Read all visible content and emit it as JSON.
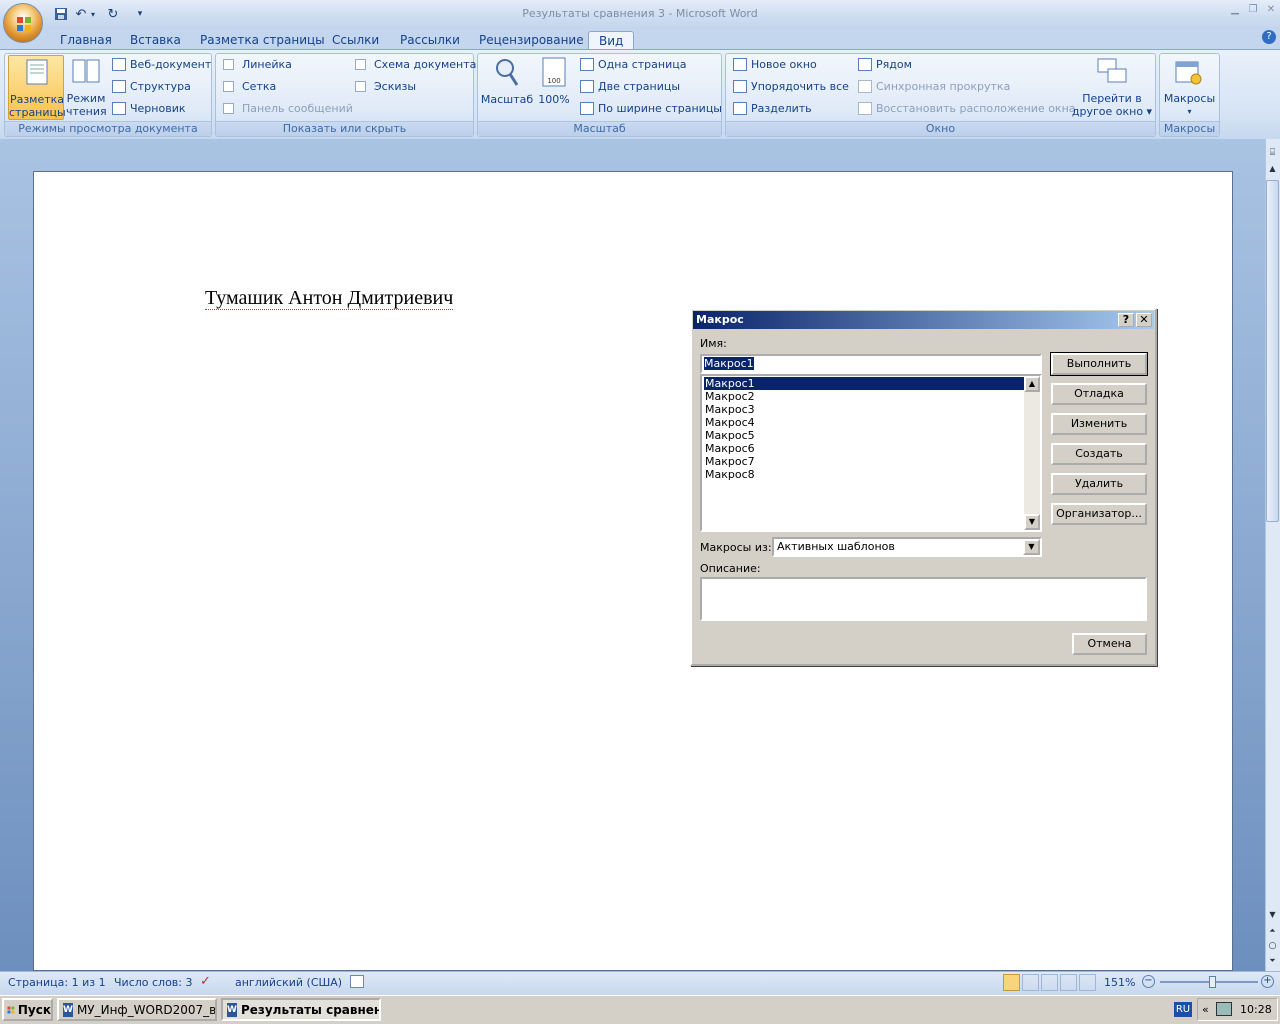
{
  "window": {
    "title": "Результаты сравнения 3 - Microsoft Word"
  },
  "tabs": [
    "Главная",
    "Вставка",
    "Разметка страницы",
    "Ссылки",
    "Рассылки",
    "Рецензирование",
    "Вид"
  ],
  "active_tab": "Вид",
  "ribbon": {
    "views": {
      "label": "Режимы просмотра документа",
      "page_layout": "Разметка страницы",
      "reading": "Режим чтения",
      "web": "Веб-документ",
      "outline": "Структура",
      "draft": "Черновик"
    },
    "show_hide": {
      "label": "Показать или скрыть",
      "ruler": "Линейка",
      "grid": "Сетка",
      "message_bar": "Панель сообщений",
      "doc_map": "Схема документа",
      "thumbnails": "Эскизы"
    },
    "zoom": {
      "label": "Масштаб",
      "zoom_btn": "Масштаб",
      "hundred": "100%",
      "one_page": "Одна страница",
      "two_pages": "Две страницы",
      "page_width": "По ширине страницы"
    },
    "window": {
      "label": "Окно",
      "new_window": "Новое окно",
      "arrange_all": "Упорядочить все",
      "split": "Разделить",
      "side_by_side": "Рядом",
      "sync_scroll": "Синхронная прокрутка",
      "reset_pos": "Восстановить расположение окна",
      "switch_1": "Перейти в",
      "switch_2": "другое окно"
    },
    "macros": {
      "label": "Макросы",
      "button": "Макросы"
    }
  },
  "document": {
    "text": "Тумашик Антон Дмитриевич"
  },
  "dialog": {
    "title": "Макрос",
    "name_label": "Имя:",
    "name_value": "Макрос1",
    "macros": [
      "Макрос1",
      "Макрос2",
      "Макрос3",
      "Макрос4",
      "Макрос5",
      "Макрос6",
      "Макрос7",
      "Макрос8"
    ],
    "selected_macro": "Макрос1",
    "buttons": {
      "run": "Выполнить",
      "debug": "Отладка",
      "edit": "Изменить",
      "create": "Создать",
      "delete": "Удалить",
      "organizer": "Организатор...",
      "cancel": "Отмена"
    },
    "macros_in_label": "Макросы из:",
    "macros_in_value": "Активных шаблонов",
    "description_label": "Описание:",
    "description_value": ""
  },
  "status": {
    "page": "Страница: 1 из 1",
    "words": "Число слов: 3",
    "language": "английский (США)",
    "zoom": "151%"
  },
  "taskbar": {
    "start": "Пуск",
    "tasks": [
      "МУ_Инф_WORD2007_в...",
      "Результаты сравнен..."
    ],
    "lang": "RU",
    "time": "10:28"
  }
}
